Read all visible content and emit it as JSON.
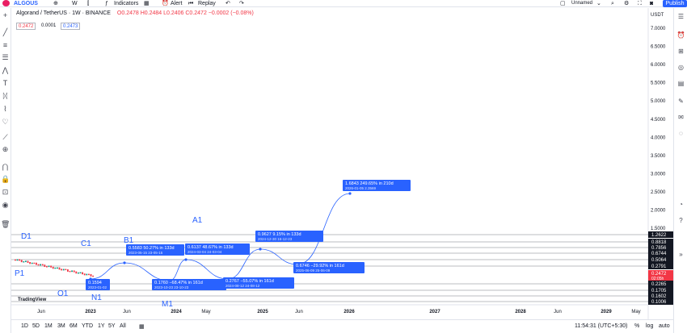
{
  "topbar": {
    "symbol": "ALGOUS",
    "interval": "W",
    "indicators": "Indicators",
    "alert": "Alert",
    "replay": "Replay",
    "layout_label": "Unnamed",
    "layout_sub": "Save",
    "publish": "Publish"
  },
  "legend": {
    "title": "Algorand / TetherUS · 1W · BINANCE",
    "ohlc": "O0.2478 H0.2484 L0.2406 C0.2472 −0.0002 (−0.08%)",
    "bid": "0.2472",
    "spread": "0.0001",
    "ask": "0.2473"
  },
  "currency": "USDT",
  "watermark": "TradingView",
  "bottombar": {
    "ranges": [
      "1D",
      "5D",
      "1M",
      "3M",
      "6M",
      "YTD",
      "1Y",
      "5Y",
      "All"
    ],
    "clock": "11:54:31 (UTC+5:30)",
    "pct": "%",
    "log": "log",
    "auto": "auto"
  },
  "chart_data": {
    "type": "line",
    "symbol": "ALGOUSDT",
    "exchange": "BINANCE",
    "interval": "1W",
    "y_ticks": [
      "7.0000",
      "6.5000",
      "6.0000",
      "5.5000",
      "5.0000",
      "4.5000",
      "4.0000",
      "3.5000",
      "3.0000",
      "2.5000",
      "2.0000",
      "1.5000"
    ],
    "x_ticks": [
      "Jun",
      "2023",
      "Jun",
      "2024",
      "May",
      "2025",
      "Jun",
      "2026",
      "2027",
      "2028",
      "Jun",
      "2029",
      "May"
    ],
    "horizontal_levels": [
      "1.2622",
      "0.8818",
      "0.7856",
      "0.6744",
      "0.5064",
      "0.2791",
      "0.2265",
      "0.1705",
      "0.1602",
      "0.1006"
    ],
    "current_price": "0.2472",
    "current_price_sub": "02:05h",
    "swing_labels": [
      "D1",
      "C1",
      "B1",
      "A1",
      "P1",
      "O1",
      "N1",
      "M1"
    ],
    "annotations": [
      {
        "price": "0.1594",
        "date": "2023-01-02"
      },
      {
        "price": "0.5583",
        "change": "50.27%",
        "days": "133d",
        "date": "2023-05-15",
        "date2": "23-05-15"
      },
      {
        "price": "0.1760",
        "change": "−68.47%",
        "days": "161d",
        "date": "2023-10-23",
        "date2": "23-10-23"
      },
      {
        "price": "0.6137",
        "change": "48.67%",
        "days": "133d",
        "date": "2024-03-04",
        "date2": "24-03-04"
      },
      {
        "price": "0.2767",
        "change": "−55.07%",
        "days": "161d",
        "date": "2024-08-12",
        "date2": "24-08-12"
      },
      {
        "price": "0.9627",
        "change": "9.15%",
        "days": "133d",
        "date": "2024-12-30",
        "date2": "16-12-23"
      },
      {
        "price": "0.6746",
        "change": "−29.92%",
        "days": "161d",
        "date": "2025-06-09",
        "date2": "25-06-09"
      },
      {
        "price": "1.6843",
        "change": "249.65%",
        "days": "210d",
        "date": "2026-01-05",
        "date2": "2.3569"
      }
    ]
  }
}
